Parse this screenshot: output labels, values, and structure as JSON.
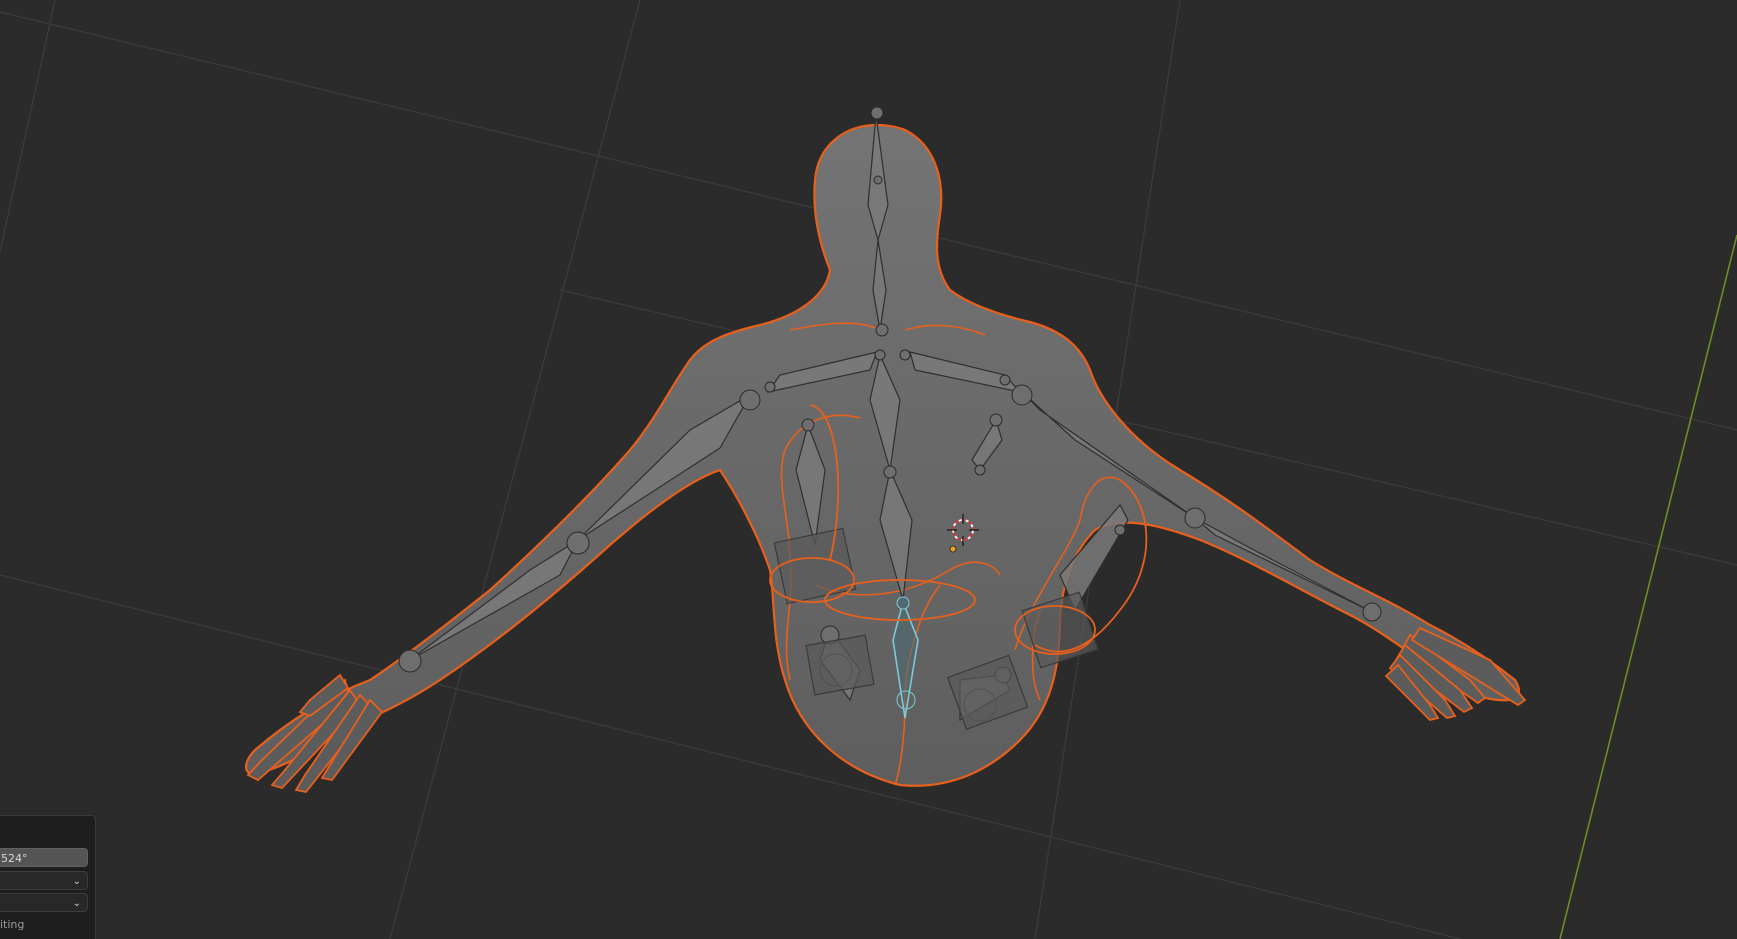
{
  "viewport": {
    "background": "#2b2b2b",
    "grid_color": "#3c3c3c",
    "y_axis_color": "#6b8e23",
    "selection_outline_color": "#e8601c",
    "active_bone_color": "#7ec8d8",
    "mesh_color": "#6f6f6f",
    "bone_color": "#7a7a7a",
    "cursor_icon": "3d-cursor-icon",
    "origin_dot_color": "#f0a020"
  },
  "operator_panel": {
    "angle_value": "524°",
    "dropdown_1_icon": "chevron-down-icon",
    "dropdown_2_icon": "chevron-down-icon",
    "editing_label": "iting"
  }
}
